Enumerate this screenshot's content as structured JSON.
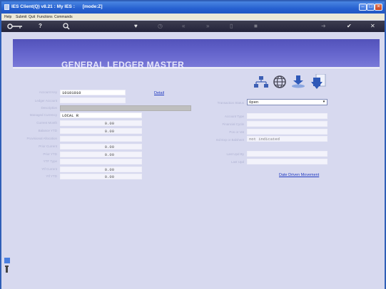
{
  "window": {
    "title": "IES Client(Q) v8.21 : My IES :      [mode:Z]",
    "controls": {
      "minimize": "‒",
      "maximize": "□",
      "close": "×"
    }
  },
  "menubar": {
    "items": [
      "Help",
      "Submit",
      "Quit",
      "Functions",
      "Commands"
    ]
  },
  "toolbar": {
    "icons": [
      "key-icon",
      "help-icon",
      "search-icon",
      "heart-icon",
      "clock-icon",
      "rewind-icon",
      "fast-forward-icon",
      "save-icon",
      "delete-icon",
      "next-icon",
      "ok-icon",
      "close-icon"
    ]
  },
  "page": {
    "title": "GENERAL LEDGER MASTER",
    "detail_link": "Detail",
    "date_driven_link": "Date Driven Movement"
  },
  "left_fields": {
    "account_key": {
      "label": "Account Key",
      "value": "10101010"
    },
    "ledger_account": {
      "label": "Ledger Account",
      "value": ""
    },
    "description": {
      "label": "Description",
      "value": ""
    },
    "managed_currency": {
      "label": "Managed Currency",
      "value": "LOCAL R"
    },
    "current_month": {
      "label": "Current Month",
      "value": "0.00"
    },
    "balance_ytd": {
      "label": "Balance YTD",
      "value": "0.00"
    },
    "provisional_allocation": {
      "label": "Provisional Allocation",
      "value": ""
    },
    "prior_current": {
      "label": "Prior Current",
      "value": "0.00"
    },
    "prior_ytd": {
      "label": "Prior YTD",
      "value": "0.00"
    },
    "ytf_type": {
      "label": "YTF Type",
      "value": ""
    },
    "ytf_current": {
      "label": "Ytf Current",
      "value": "0.00"
    },
    "ytf_ytd": {
      "label": "Ytf YTD",
      "value": "0.00"
    }
  },
  "right_fields": {
    "transaction_status": {
      "label": "Transaction Status",
      "value": "Open"
    },
    "account_type": {
      "label": "Account Type",
      "value": ""
    },
    "financial_cycle": {
      "label": "Financial Cycle",
      "value": ""
    },
    "pos_or_vat": {
      "label": "Pos or Vat",
      "value": ""
    },
    "ind_bal": {
      "label": "Ind Exp or Balsheet",
      "value": "not indicated"
    },
    "last_upd_by": {
      "label": "Last Upd By",
      "value": ""
    },
    "last_upd": {
      "label": "Last Upd",
      "value": ""
    }
  },
  "action_icons": [
    "org-chart-icon",
    "globe-icon",
    "download-icon",
    "document-icon"
  ],
  "colors": {
    "title_bar": "#2660d0",
    "toolbar": "#2a2a40",
    "banner": "#6363cc",
    "content_bg": "#d7d9ef",
    "link": "#1f39c0"
  }
}
